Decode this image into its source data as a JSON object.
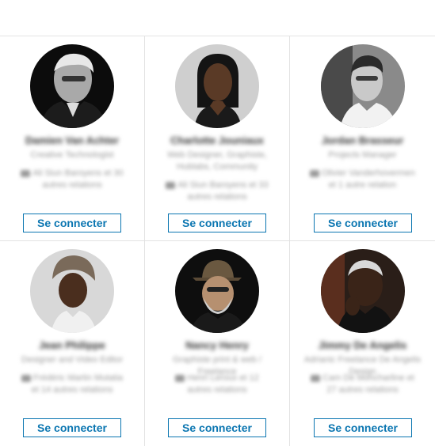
{
  "people": [
    {
      "name": "Damien Van Achter",
      "headline": "Creative Technologist",
      "mutual": "Ali Siun Baroyens et 30 autres relations",
      "connect_label": "Se connecter"
    },
    {
      "name": "Charlotte Jouniaux",
      "headline": "Web Designer, Graphiste, Hublabs, Community",
      "mutual": "Ali Siun Baroyens et 33 autres relations",
      "connect_label": "Se connecter"
    },
    {
      "name": "Jordan Brasseur",
      "headline": "Projects Manager",
      "mutual": "Olivier Vanderhovermen et 1 autre relation",
      "connect_label": "Se connecter"
    },
    {
      "name": "Jean Philippe",
      "headline": "Designer and Video Editor",
      "mutual": "Frédéric Martin Mutatia et 14 autres relations",
      "connect_label": "Se connecter"
    },
    {
      "name": "Nancy Henry",
      "headline": "Graphiste print & web / Freelance",
      "mutual": "Henri Leroux et 12 autres relations",
      "connect_label": "Se connecter"
    },
    {
      "name": "Jimmy De Angelis",
      "headline": "Adrianic Freelance De Angelis Design",
      "mutual": "Cam De Moncharline et 27 autres relations",
      "connect_label": "Se connecter"
    }
  ]
}
